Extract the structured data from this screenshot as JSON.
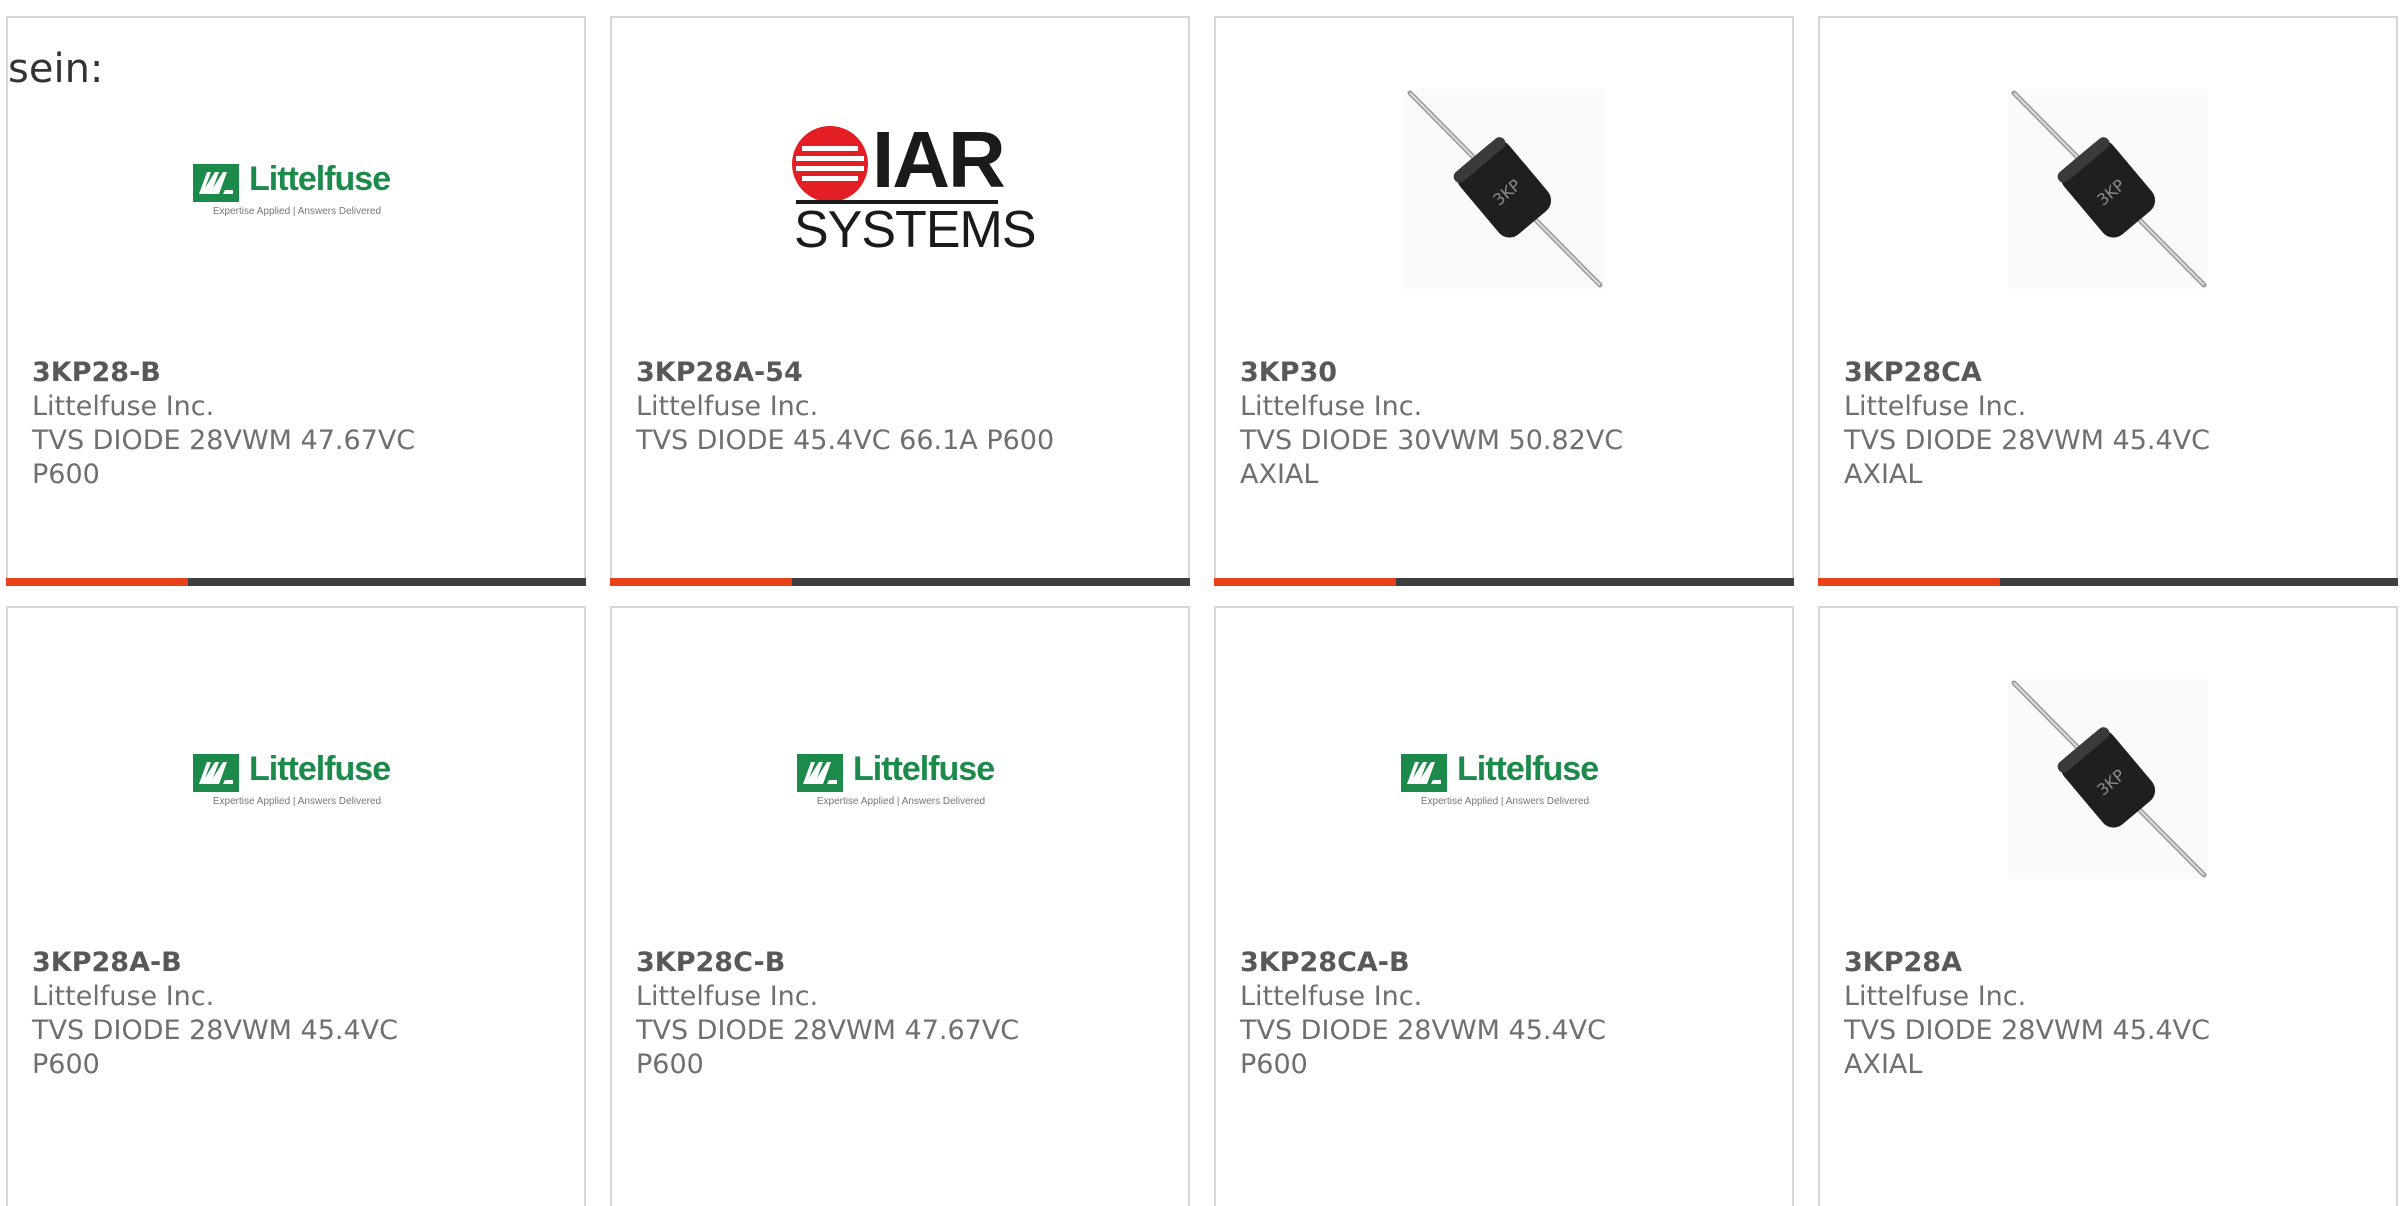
{
  "intro_text": "sein:",
  "colors": {
    "accent": "#e8411a",
    "bar": "#3f3f3f",
    "card_border": "#d6d6d6",
    "littelfuse_green": "#1b8a4b",
    "text": "#6f6f6f"
  },
  "logos": {
    "littelfuse": {
      "name": "Littelfuse",
      "tagline": "Expertise Applied | Answers Delivered"
    },
    "iar": {
      "name": "IAR",
      "subtitle": "SYSTEMS"
    }
  },
  "diode_marking": "3KP",
  "products": [
    {
      "part_number": "3KP28-B",
      "manufacturer": "Littelfuse Inc.",
      "description": "TVS DIODE 28VWM 47.67VC P600",
      "image": "littelfuse-logo"
    },
    {
      "part_number": "3KP28A-54",
      "manufacturer": "Littelfuse Inc.",
      "description": "TVS DIODE 45.4VC 66.1A P600",
      "image": "iar-systems-logo"
    },
    {
      "part_number": "3KP30",
      "manufacturer": "Littelfuse Inc.",
      "description": "TVS DIODE 30VWM 50.82VC AXIAL",
      "image": "axial-diode-photo"
    },
    {
      "part_number": "3KP28CA",
      "manufacturer": "Littelfuse Inc.",
      "description": "TVS DIODE 28VWM 45.4VC AXIAL",
      "image": "axial-diode-photo"
    },
    {
      "part_number": "3KP28A-B",
      "manufacturer": "Littelfuse Inc.",
      "description": "TVS DIODE 28VWM 45.4VC P600",
      "image": "littelfuse-logo"
    },
    {
      "part_number": "3KP28C-B",
      "manufacturer": "Littelfuse Inc.",
      "description": "TVS DIODE 28VWM 47.67VC P600",
      "image": "littelfuse-logo"
    },
    {
      "part_number": "3KP28CA-B",
      "manufacturer": "Littelfuse Inc.",
      "description": "TVS DIODE 28VWM 45.4VC P600",
      "image": "littelfuse-logo"
    },
    {
      "part_number": "3KP28A",
      "manufacturer": "Littelfuse Inc.",
      "description": "TVS DIODE 28VWM 45.4VC AXIAL",
      "image": "axial-diode-photo"
    }
  ]
}
